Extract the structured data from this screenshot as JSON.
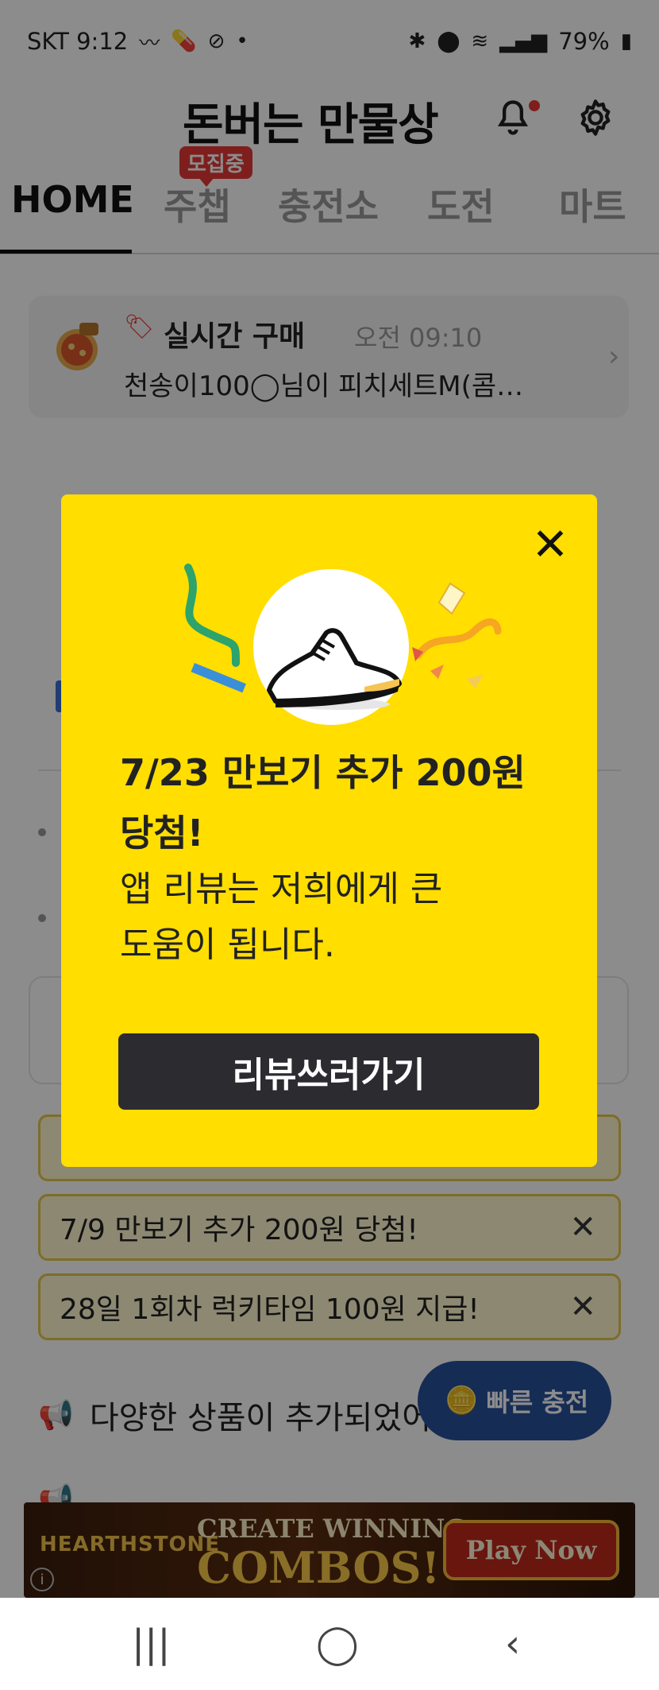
{
  "status_bar": {
    "carrier_time": "SKT 9:12",
    "battery": "79%"
  },
  "header": {
    "title": "돈버는 만물상",
    "icons": [
      "bell-icon",
      "gear-icon"
    ]
  },
  "tabs": [
    {
      "label": "HOME",
      "active": true
    },
    {
      "label": "주챕",
      "badge": "모집중"
    },
    {
      "label": "충전소"
    },
    {
      "label": "도전"
    },
    {
      "label": "마트"
    }
  ],
  "live_purchase": {
    "title": "실시간 구매",
    "time": "오전 09:10",
    "text": "천송이100◯님이 피치세트M(콤…"
  },
  "notices": [
    {
      "text": "7/9 만보기 추가 200원 당첨!"
    },
    {
      "text": "28일 1회차 럭키타임 100원 지급!"
    }
  ],
  "news": [
    {
      "text": "다양한 상품이 추가되었어요"
    }
  ],
  "fab": {
    "label": "빠른 충전"
  },
  "ad": {
    "logo": "HEARTHSTONE",
    "headline1": "CREATE WINNING",
    "headline2": "COMBOS!",
    "cta": "Play Now"
  },
  "modal": {
    "title": "7/23 만보기 추가 200원 당첨!",
    "subtitle": "앱 리뷰는 저희에게 큰 도움이 됩니다.",
    "button_label": "리뷰쓰러가기",
    "colors": {
      "background": "#ffde00",
      "button": "#2c2c30"
    }
  }
}
